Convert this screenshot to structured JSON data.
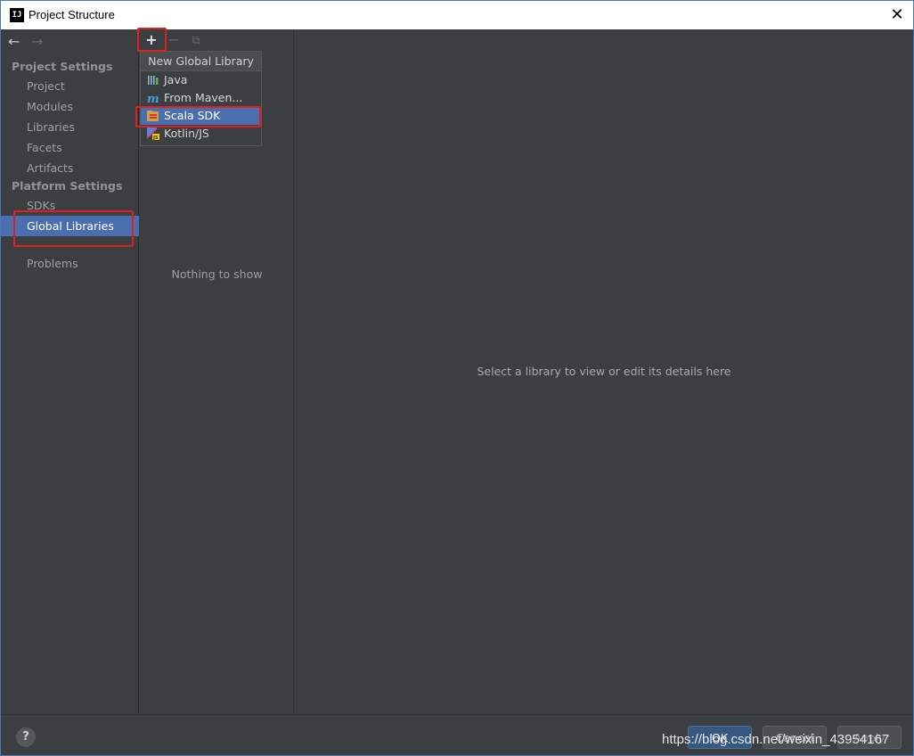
{
  "window": {
    "title": "Project Structure",
    "app_icon": "IJ",
    "close_glyph": "✕"
  },
  "nav": {
    "back": "←",
    "forward": "→"
  },
  "sidebar": {
    "project_settings_title": "Project Settings",
    "project_items": [
      "Project",
      "Modules",
      "Libraries",
      "Facets",
      "Artifacts"
    ],
    "platform_settings_title": "Platform Settings",
    "platform_items": [
      "SDKs",
      "Global Libraries"
    ],
    "selected": "Global Libraries",
    "problems": "Problems"
  },
  "toolbar": {
    "add": "+",
    "remove": "−",
    "copy": "⧉"
  },
  "middle": {
    "empty_text": "Nothing to show"
  },
  "popup": {
    "header": "New Global Library",
    "items": [
      {
        "label": "Java",
        "icon": "java-library-icon"
      },
      {
        "label": "From Maven...",
        "icon": "maven-icon"
      },
      {
        "label": "Scala SDK",
        "icon": "scala-sdk-icon"
      },
      {
        "label": "Kotlin/JS",
        "icon": "kotlin-js-icon"
      }
    ],
    "selected": "Scala SDK"
  },
  "details": {
    "placeholder": "Select a library to view or edit its details here"
  },
  "bottom": {
    "help": "?",
    "ok": "OK",
    "cancel": "Cancel",
    "apply": "Apply",
    "watermark": "https://blog.csdn.net/weixin_43954167"
  },
  "colors": {
    "accent": "#4b6eaf",
    "highlight": "#e02020",
    "background": "#3c3f41"
  }
}
